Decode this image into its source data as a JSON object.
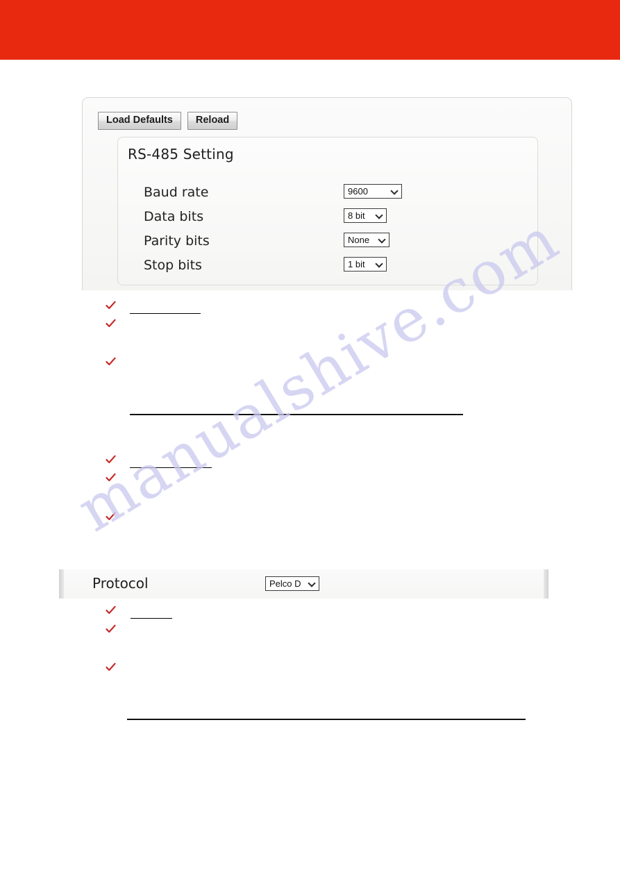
{
  "page": {
    "banner_color": "#e8280f",
    "watermark_text": "manualshive.com",
    "watermark_color": "#c9c9ef"
  },
  "settings_panel": {
    "toolbar": {
      "load_defaults_label": "Load Defaults",
      "reload_label": "Reload"
    },
    "section": {
      "title": "RS-485 Setting",
      "fields": [
        {
          "label": "Baud rate",
          "value": "9600"
        },
        {
          "label": "Data bits",
          "value": "8 bit"
        },
        {
          "label": "Parity bits",
          "value": "None"
        },
        {
          "label": "Stop bits",
          "value": "1 bit"
        }
      ]
    }
  },
  "protocol_row": {
    "label": "Protocol",
    "value": "Pelco D"
  },
  "bullet_groups": [
    {
      "items": [
        {
          "text": ""
        },
        {
          "text": ""
        },
        {
          "text": ""
        }
      ]
    },
    {
      "items": [
        {
          "text": ""
        },
        {
          "text": ""
        },
        {
          "text": ""
        }
      ]
    },
    {
      "items": [
        {
          "text": ""
        },
        {
          "text": ""
        },
        {
          "text": ""
        }
      ]
    }
  ]
}
